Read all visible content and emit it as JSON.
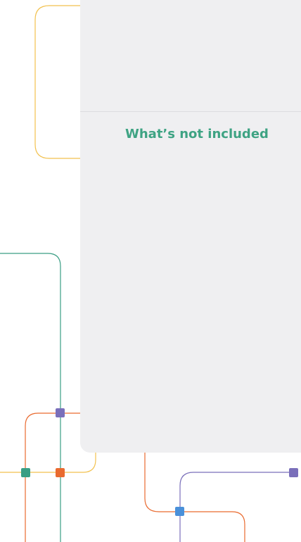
{
  "panel": {
    "heading": "What’s not included"
  },
  "colors": {
    "yellow_line": "#f2c14e",
    "green_line": "#3a9e84",
    "orange_line": "#e96a2f",
    "purple_line": "#7a6fba",
    "blue_node": "#4a90d9",
    "heading_green": "#3ea383",
    "panel_bg": "#efeff1"
  }
}
